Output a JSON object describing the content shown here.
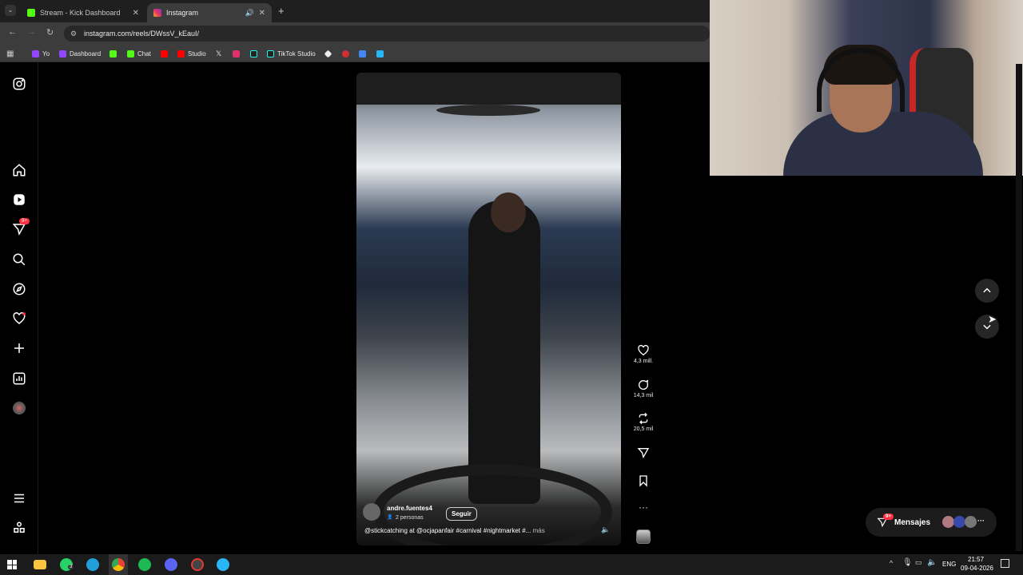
{
  "browser": {
    "tabs": [
      {
        "label": "Stream - Kick Dashboard",
        "active": false
      },
      {
        "label": "Instagram",
        "active": true
      }
    ],
    "url": "instagram.com/reels/DWssV_kEauI/",
    "bookmarks": [
      "Yo",
      "Dashboard",
      "Chat",
      "Studio",
      "TikTok Studio"
    ]
  },
  "sidebar": {
    "items": [
      "instagram-logo",
      "home",
      "reels",
      "messages",
      "search",
      "explore",
      "notifications",
      "create",
      "dashboard",
      "profile",
      "more",
      "meta"
    ],
    "messages_badge": "9+"
  },
  "reel": {
    "username": "andre.fuentes4",
    "collab": "2 personas",
    "follow_label": "Seguir",
    "caption": "@stickcatching at @ocjapanfair #carnival #nightmarket #...",
    "more_label": "más",
    "likes": "4,3 mill.",
    "comments": "14,3 mil",
    "reposts": "20,5 mil"
  },
  "messages": {
    "label": "Mensajes",
    "badge": "9+"
  },
  "taskbar": {
    "lang": "ENG",
    "time": "21:57",
    "date": "09-04-2026",
    "whatsapp_badge": "3"
  }
}
